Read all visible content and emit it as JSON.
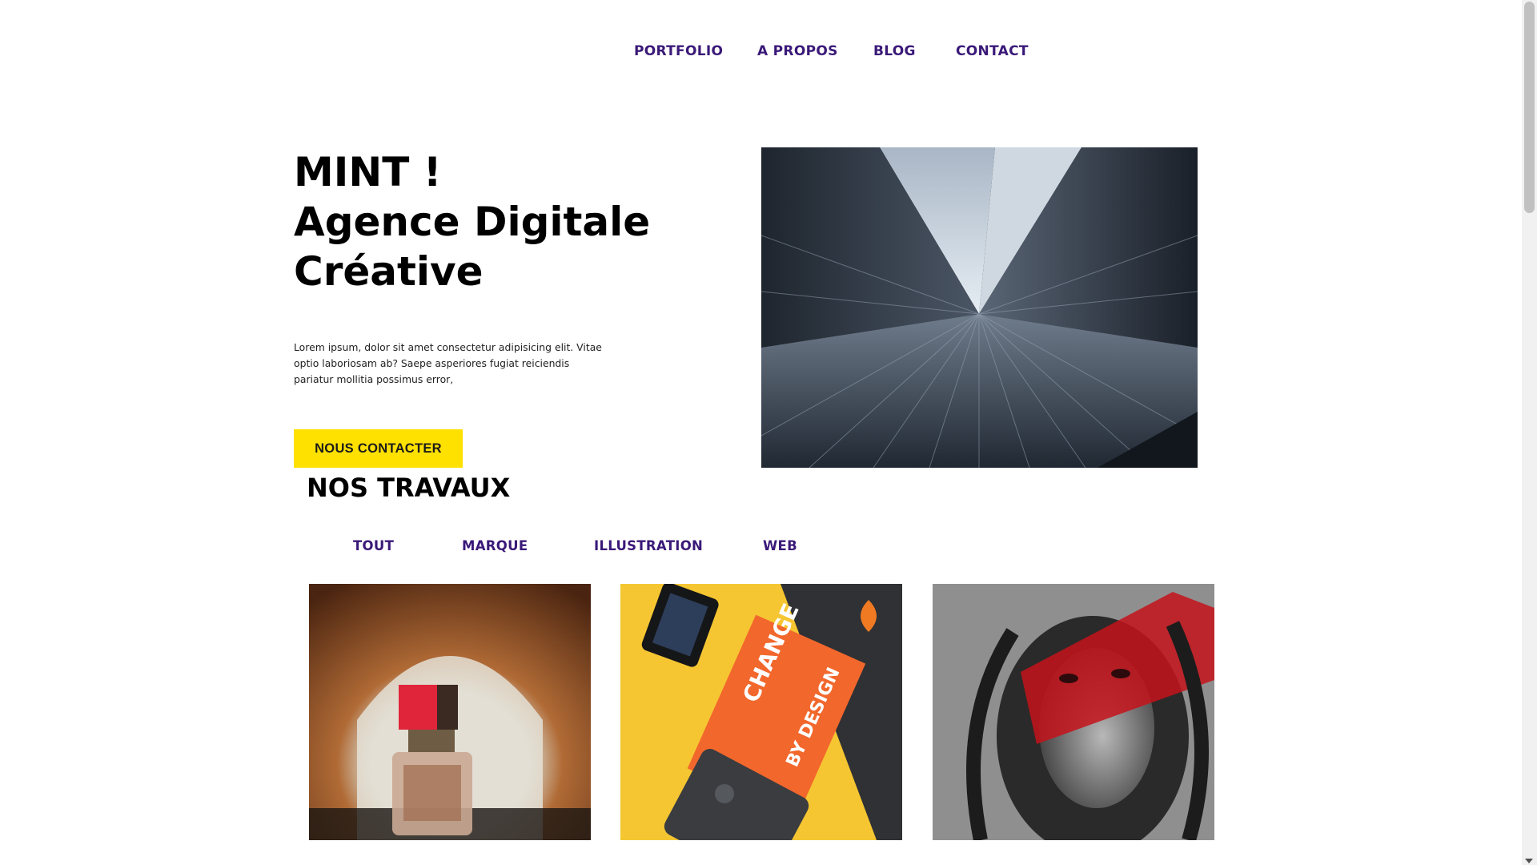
{
  "nav": {
    "items": [
      "PORTFOLIO",
      "A PROPOS",
      "BLOG",
      "CONTACT"
    ]
  },
  "hero": {
    "title_line1": "MINT !",
    "title_line2": "Agence Digitale",
    "title_line3": "Créative",
    "text": "Lorem ipsum, dolor sit amet consectetur adipisicing elit. Vitae optio laboriosam ab? Saepe asperiores fugiat reiciendis pariatur mollitia possimus error,",
    "cta_label": "NOUS CONTACTER"
  },
  "works": {
    "title": "NOS TRAVAUX",
    "filters": [
      "TOUT",
      "MARQUE",
      "ILLUSTRATION",
      "WEB"
    ]
  },
  "colors": {
    "accent_purple": "#3a1978",
    "cta_yellow": "#ffe100",
    "text_dark": "#000000"
  }
}
